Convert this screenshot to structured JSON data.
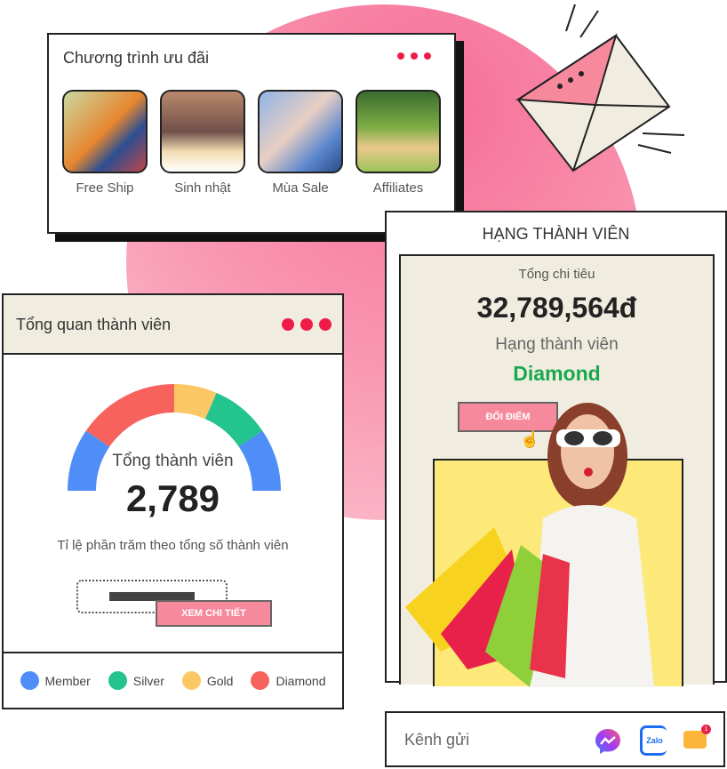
{
  "promotions": {
    "title": "Chương trình ưu đãi",
    "menu_icon": "more-dots-icon",
    "items": [
      {
        "label": "Free Ship",
        "image": "delivery-person-photo"
      },
      {
        "label": "Sinh nhật",
        "image": "birthday-cake-photo"
      },
      {
        "label": "Mùa Sale",
        "image": "shopping-women-photo"
      },
      {
        "label": "Affiliates",
        "image": "picnic-friends-photo"
      }
    ]
  },
  "overview": {
    "title": "Tổng quan thành viên",
    "menu_icon": "more-dots-icon",
    "total_label": "Tổng thành viên",
    "total_value": "2,789",
    "subtitle": "Tỉ lệ phần trăm theo tổng số thành viên",
    "detail_button": "XEM CHI TIẾT",
    "gauge_segments_percent": [
      {
        "color": "#4f8ef7",
        "share": 19
      },
      {
        "color": "#f7625d",
        "share": 31
      },
      {
        "color": "#fbc865",
        "share": 13
      },
      {
        "color": "#23c48e",
        "share": 18
      },
      {
        "color": "#4f8ef7",
        "share": 19
      }
    ],
    "legend": [
      {
        "label": "Member",
        "color": "#4f8ef7"
      },
      {
        "label": "Silver",
        "color": "#23c48e"
      },
      {
        "label": "Gold",
        "color": "#fbc865"
      },
      {
        "label": "Diamond",
        "color": "#f7625d"
      }
    ]
  },
  "rank": {
    "title": "HẠNG THÀNH VIÊN",
    "spend_label": "Tổng chi tiêu",
    "spend_value": "32,789,564đ",
    "rank_label": "Hạng thành viên",
    "rank_value": "Diamond",
    "rank_color": "#1aa84f",
    "redeem_button": "ĐỔI ĐIỂM",
    "image": "woman-with-shopping-bags-photo"
  },
  "channels": {
    "label": "Kênh gửi",
    "icons": [
      "messenger-icon",
      "zalo-icon",
      "sms-icon"
    ],
    "zalo_text": "Zalo",
    "sms_badge": "1"
  },
  "colors": {
    "accent": "#ee1c47",
    "button": "#f7899d",
    "panel": "#f0ede0"
  }
}
